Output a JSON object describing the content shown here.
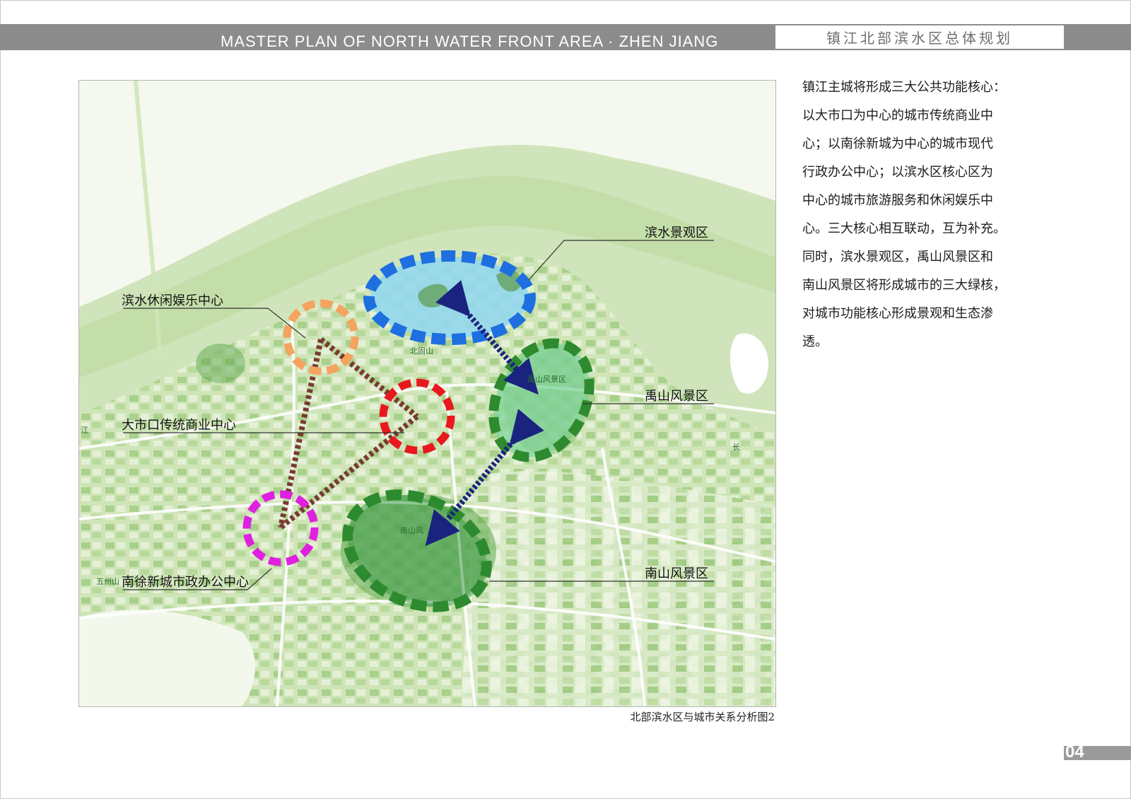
{
  "header": {
    "title_en": "MASTER PLAN OF NORTH WATER FRONT AREA · ZHEN  JIANG",
    "title_cn": "镇江北部滨水区总体规划"
  },
  "map": {
    "labels": {
      "waterfront_leisure": "滨水休闲娱乐中心",
      "dashikou": "大市口传统商业中心",
      "nanxu": "南徐新城市政办公中心",
      "waterfront_scenic": "滨水景观区",
      "yushan": "禹山风景区",
      "nanshan": "南山风景区"
    },
    "place_names": {
      "beigushan": "北固山",
      "wuzhoushan": "五州山",
      "jiang": "江",
      "chang": "长",
      "yushan_small": "禹山风景区",
      "nanshan_small": "南山风"
    },
    "colors": {
      "leisure_ring": "#f4a460",
      "dashikou_ring": "#e8181e",
      "nanxu_ring": "#e020e0",
      "scenic_blue": "#1e6fe0",
      "scenic_green": "#2e8a2e",
      "link_brown": "#7a3a32",
      "link_navy": "#1a237e"
    }
  },
  "caption": "北部滨水区与城市关系分析图2",
  "description": [
    "镇江主城将形成三大公共功能核心：",
    "以大市口为中心的城市传统商业中",
    "心；以南徐新城为中心的城市现代",
    "行政办公中心；以滨水区核心区为",
    "中心的城市旅游服务和休闲娱乐中",
    "心。三大核心相互联动，互为补充。",
    "同时，滨水景观区，禹山风景区和",
    "南山风景区将形成城市的三大绿核，",
    "对城市功能核心形成景观和生态渗",
    "透。"
  ],
  "page_number": "04"
}
